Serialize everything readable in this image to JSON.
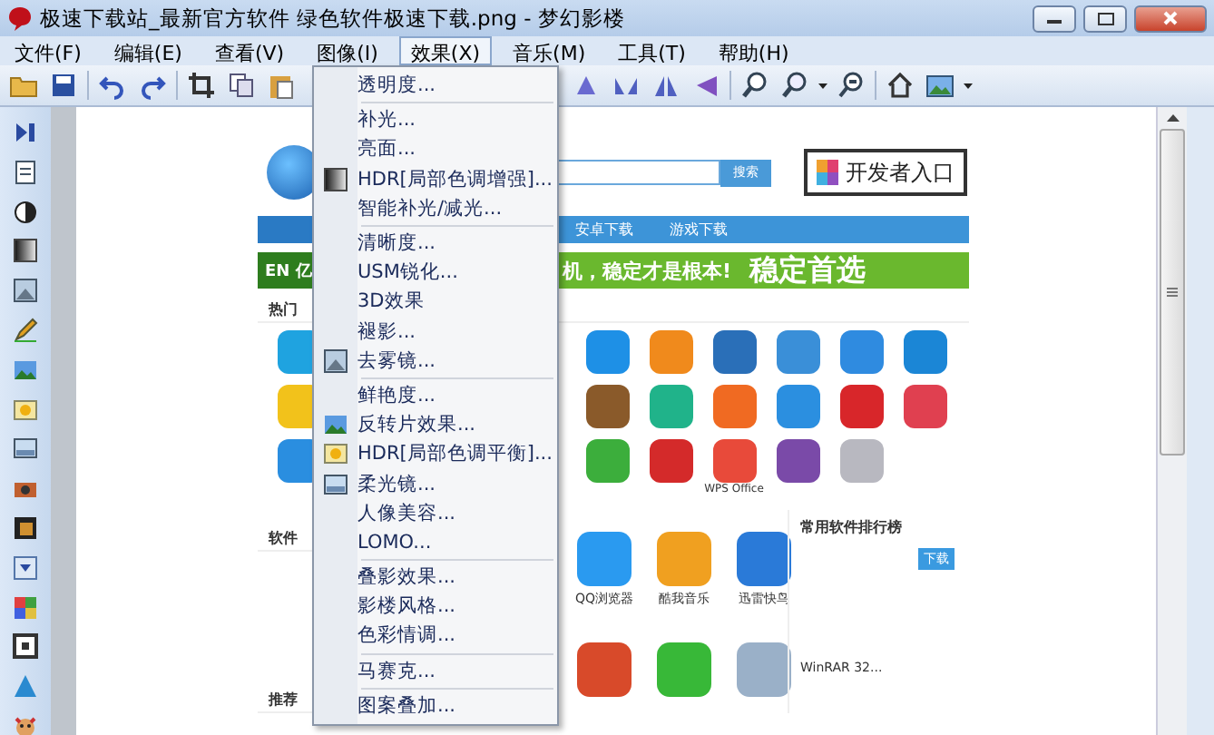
{
  "window": {
    "title": "极速下载站_最新官方软件 绿色软件极速下载.png - 梦幻影楼"
  },
  "menu_bar": [
    {
      "label": "文件(F)",
      "selected": false
    },
    {
      "label": "编辑(E)",
      "selected": false
    },
    {
      "label": "查看(V)",
      "selected": false
    },
    {
      "label": "图像(I)",
      "selected": false
    },
    {
      "label": "效果(X)",
      "selected": true
    },
    {
      "label": "音乐(M)",
      "selected": false
    },
    {
      "label": "工具(T)",
      "selected": false
    },
    {
      "label": "帮助(H)",
      "selected": false
    }
  ],
  "effects_menu": {
    "groups": [
      [
        {
          "label": "透明度...",
          "kind": "plain"
        }
      ],
      [
        {
          "label": "补光...",
          "kind": "plain"
        },
        {
          "label": "亮面...",
          "kind": "plain"
        },
        {
          "label": "HDR[局部色调增强]...",
          "kind": "gradient"
        },
        {
          "label": "智能补光/减光...",
          "kind": "plain"
        }
      ],
      [
        {
          "label": "清晰度...",
          "kind": "plain"
        },
        {
          "label": "USM锐化...",
          "kind": "plain"
        },
        {
          "label": "3D效果",
          "kind": "plain"
        },
        {
          "label": "褪影...",
          "kind": "plain"
        },
        {
          "label": "去雾镜...",
          "kind": "picture"
        }
      ],
      [
        {
          "label": "鲜艳度...",
          "kind": "plain"
        },
        {
          "label": "反转片效果...",
          "kind": "landscape"
        },
        {
          "label": "HDR[局部色调平衡]...",
          "kind": "sun"
        },
        {
          "label": "柔光镜...",
          "kind": "panel"
        },
        {
          "label": "人像美容...",
          "kind": "plain"
        },
        {
          "label": "LOMO...",
          "kind": "plain"
        }
      ],
      [
        {
          "label": "叠影效果...",
          "kind": "plain"
        },
        {
          "label": "影楼风格...",
          "kind": "plain"
        },
        {
          "label": "色彩情调...",
          "kind": "plain"
        }
      ],
      [
        {
          "label": "马赛克...",
          "kind": "plain"
        }
      ],
      [
        {
          "label": "图案叠加...",
          "kind": "plain"
        }
      ]
    ]
  },
  "image": {
    "search_button": "搜索",
    "developer_link": "开发者入口",
    "nav": [
      "安卓下载",
      "游戏下载"
    ],
    "banner_badge": "EN 亿",
    "banner_text": "机，稳定才是根本!",
    "banner_slogan": "稳定首选",
    "hot_title": "热门",
    "apps": [
      {
        "color": "#1fa3e0"
      },
      {
        "color": "#1e90e6"
      },
      {
        "color": "#f08a1c"
      },
      {
        "color": "#2a6fb8"
      },
      {
        "color": "#3a8fd8"
      },
      {
        "color": "#2f8be0"
      },
      {
        "color": "#1b86d6"
      },
      {
        "color": "#f2c21b"
      },
      {
        "color": "#8a5a2a"
      },
      {
        "color": "#20b38a"
      },
      {
        "color": "#f06a22"
      },
      {
        "color": "#2b8fe0"
      },
      {
        "color": "#d8262a"
      },
      {
        "color": "#e04050"
      },
      {
        "color": "#2a8ee0"
      },
      {
        "color": "#3cae3c"
      },
      {
        "color": "#d42a2a"
      },
      {
        "color": "#e84a3a",
        "label": "WPS Office"
      },
      {
        "color": "#7a4aa8"
      },
      {
        "color": "#b8b8c0"
      }
    ],
    "software_title": "软件",
    "recommend_title": "推荐",
    "featured": [
      {
        "label": "QQ浏览器",
        "color": "#2a9af0"
      },
      {
        "label": "酷我音乐",
        "color": "#f0a020"
      },
      {
        "label": "迅雷快鸟",
        "color": "#2a7ad8"
      },
      {
        "color": "#d84a2a"
      },
      {
        "color": "#38b838"
      },
      {
        "color": "#9ab0c8"
      }
    ],
    "ranking_title": "常用软件排行榜",
    "ranking_badge": "下载",
    "ranking": [
      "WinRAR 32..."
    ]
  }
}
